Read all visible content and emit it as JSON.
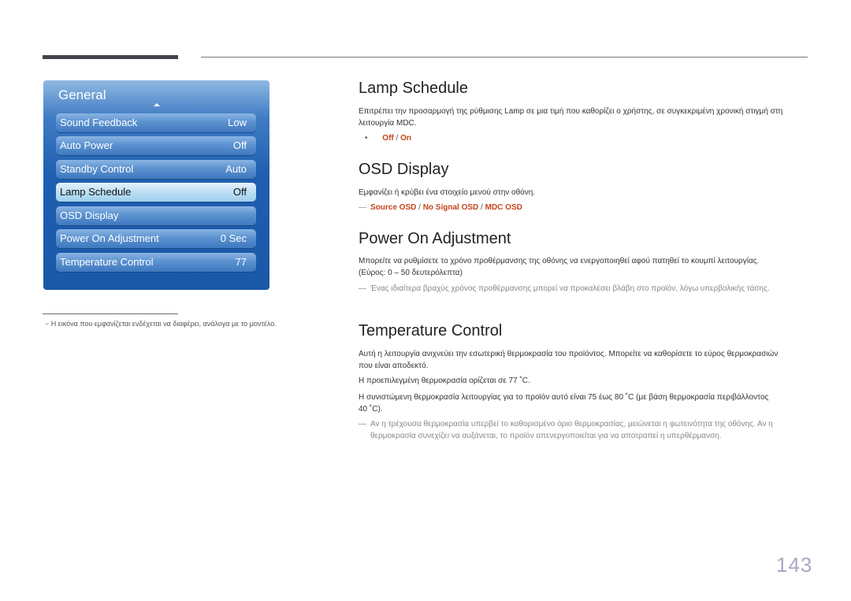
{
  "menu": {
    "title": "General",
    "items": [
      {
        "label": "Sound Feedback",
        "value": "Low"
      },
      {
        "label": "Auto Power",
        "value": "Off"
      },
      {
        "label": "Standby Control",
        "value": "Auto"
      },
      {
        "label": "Lamp Schedule",
        "value": "Off",
        "selected": true
      },
      {
        "label": "OSD Display",
        "value": ""
      },
      {
        "label": "Power On Adjustment",
        "value": "0 Sec"
      },
      {
        "label": "Temperature Control",
        "value": "77"
      }
    ]
  },
  "footnote": "− Η εικόνα που εμφανίζεται ενδέχεται να διαφέρει, ανάλογα με το μοντέλο.",
  "sections": {
    "lamp": {
      "title": "Lamp Schedule",
      "text": "Επιτρέπει την προσαρμογή της ρύθμισης Lamp σε μια τιμή που καθορίζει ο χρήστης, σε συγκεκριμένη χρονική στιγμή στη λειτουργία MDC.",
      "bullet": "•",
      "options": [
        "Off",
        "On"
      ],
      "separator": " / "
    },
    "osd": {
      "title": "OSD Display",
      "text": "Εμφανίζει ή κρύβει ένα στοιχείο μενού στην οθόνη.",
      "dash": "—",
      "options": [
        "Source OSD",
        "No Signal OSD",
        "MDC OSD"
      ],
      "separator": " / "
    },
    "power": {
      "title": "Power On Adjustment",
      "text": "Μπορείτε να ρυθμίσετε το χρόνο προθέρμανσης της οθόνης να ενεργοποιηθεί αφού πατηθεί το κουμπί λειτουργίας. (Εύρος: 0 – 50 δευτερόλεπτα)",
      "dash": "—",
      "note": "Ένας ιδιαίτερα βραχύς χρόνος προθέρμανσης μπορεί να προκαλέσει βλάβη στο προϊόν, λόγω υπερβολικής τάσης."
    },
    "temp": {
      "title": "Temperature Control",
      "text1": "Αυτή η λειτουργία ανιχνεύει την εσωτερική θερμοκρασία του προϊόντος. Μπορείτε να καθορίσετε το εύρος θερμοκρασιών που είναι αποδεκτό.",
      "text2": "Η προεπιλεγμένη θερμοκρασία ορίζεται σε 77 ˚C.",
      "text3": "Η συνιστώμενη θερμοκρασία λειτουργίας για το προϊόν αυτό είναι 75 έως 80 ˚C (με βάση θερμοκρασία περιβάλλοντος 40 ˚C).",
      "dash": "—",
      "note": "Αν η τρέχουσα θερμοκρασία υπερβεί το καθορισμένο όριο θερμοκρασίας, μειώνεται η φωτεινότητα της οθόνης. Αν η θερμοκρασία συνεχίζει να αυξάνεται, το προϊόν απενεργοποιείται για να αποτραπεί η υπερθέρμανση."
    }
  },
  "page_number": "143",
  "colors": {
    "accent": "#c4441c",
    "menu_blue": "#1f5fb0",
    "page_number": "#a9a9c4"
  }
}
